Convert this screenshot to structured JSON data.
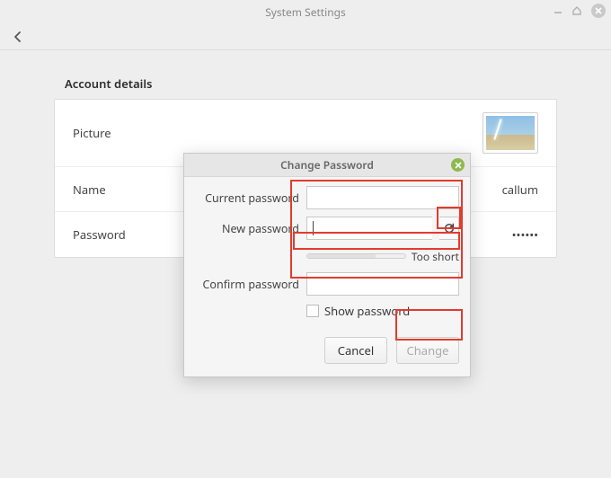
{
  "window": {
    "title": "System Settings"
  },
  "section": {
    "title": "Account details",
    "rows": {
      "picture_label": "Picture",
      "name_label": "Name",
      "name_value": "callum",
      "password_label": "Password",
      "password_value": "••••••"
    }
  },
  "dialog": {
    "title": "Change Password",
    "current_label": "Current password",
    "new_label": "New password",
    "confirm_label": "Confirm password",
    "strength_text": "Too short",
    "show_label": "Show password",
    "cancel": "Cancel",
    "change": "Change"
  }
}
